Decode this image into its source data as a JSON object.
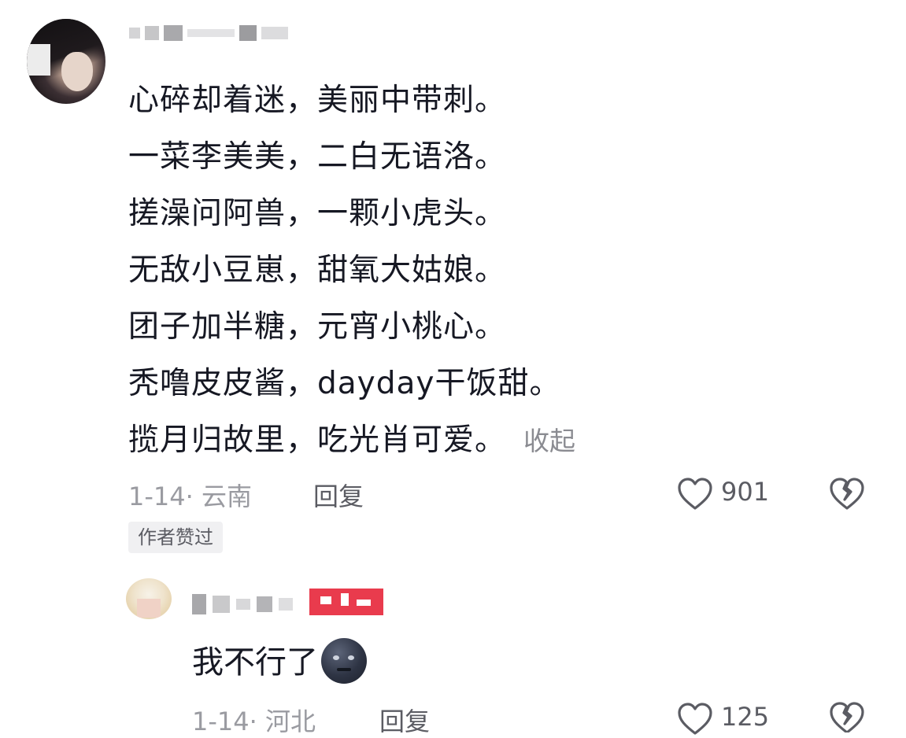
{
  "comment": {
    "lines": [
      "心碎却着迷，美丽中带刺。",
      "一菜李美美，二白无语洛。",
      "搓澡问阿兽，一颗小虎头。",
      "无敌小豆崽，甜氧大姑娘。",
      "团子加半糖，元宵小桃心。",
      "秃噜皮皮酱，dayday干饭甜。",
      "揽月归故里，吃光肖可爱。"
    ],
    "collapse_label": "收起",
    "date_location": "1-14· 云南",
    "reply_label": "回复",
    "like_count": "901",
    "author_liked_tag": "作者赞过"
  },
  "reply": {
    "text": "我不行了",
    "emoji_icon": "dark-moon-face-emoji",
    "date_location": "1-14· 河北",
    "reply_label": "回复",
    "like_count": "125"
  },
  "colors": {
    "text": "#161823",
    "secondary": "#9a9ba1",
    "action": "#5b5c63",
    "badge": "#e93b4d"
  }
}
